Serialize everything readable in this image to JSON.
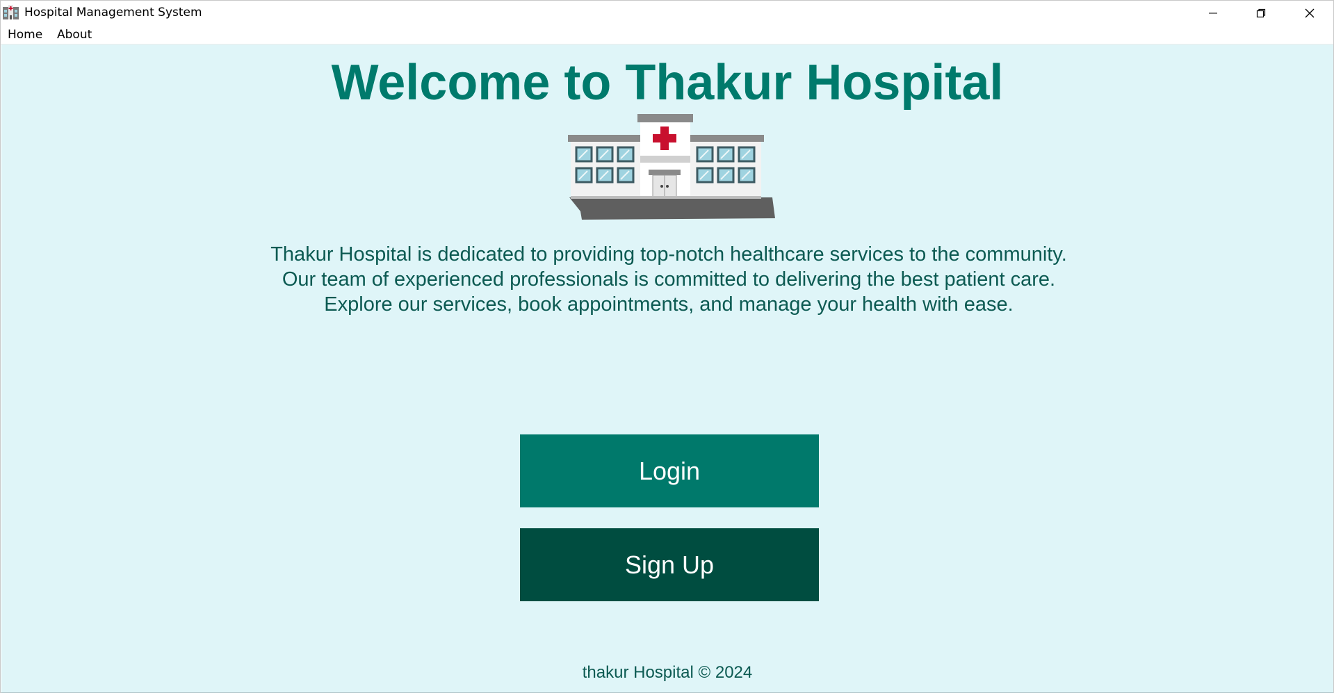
{
  "window": {
    "title": "Hospital Management System",
    "app_icon": "hospital-icon",
    "controls": [
      "minimize-icon",
      "restore-icon",
      "close-icon"
    ]
  },
  "menu": {
    "items": [
      {
        "label": "Home"
      },
      {
        "label": "About"
      }
    ]
  },
  "main": {
    "heading": "Welcome to Thakur Hospital",
    "image_icon": "hospital-building-icon",
    "description_lines": [
      "Thakur Hospital is dedicated to providing top-notch healthcare services to the community.",
      "Our team of experienced professionals is committed to delivering the best patient care.",
      "Explore our services, book appointments, and manage your health with ease."
    ],
    "login_label": "Login",
    "signup_label": "Sign Up",
    "footer": "thakur Hospital © 2024"
  },
  "colors": {
    "background": "#dff5f8",
    "heading": "#007a6c",
    "text": "#0c5a52",
    "login_button": "#00796b",
    "signup_button": "#004d40"
  }
}
